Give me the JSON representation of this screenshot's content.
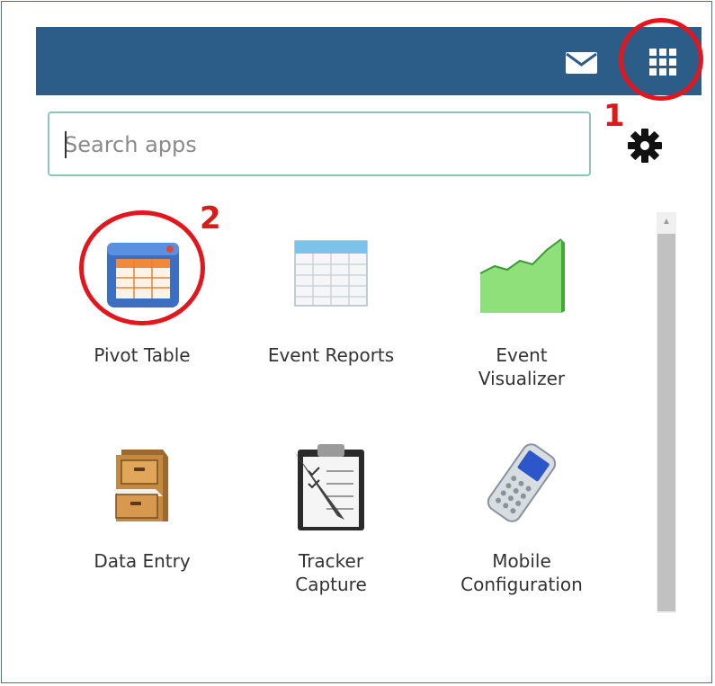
{
  "header": {
    "mail_icon": "mail-icon",
    "apps_icon": "apps-grid-icon",
    "background": "#2b5d88"
  },
  "annotations": {
    "step1": "1",
    "step2": "2",
    "color": "#e3161d"
  },
  "search": {
    "placeholder": "Search apps",
    "value": ""
  },
  "settings_icon": "gear-icon",
  "apps": [
    {
      "label_lines": [
        "Pivot Table"
      ],
      "icon": "pivot-table-icon"
    },
    {
      "label_lines": [
        "Event Reports"
      ],
      "icon": "event-reports-icon"
    },
    {
      "label_lines": [
        "Event",
        "Visualizer"
      ],
      "icon": "event-visualizer-icon"
    },
    {
      "label_lines": [
        "Data Entry"
      ],
      "icon": "data-entry-icon"
    },
    {
      "label_lines": [
        "Tracker",
        "Capture"
      ],
      "icon": "tracker-capture-icon"
    },
    {
      "label_lines": [
        "Mobile",
        "Configuration"
      ],
      "icon": "mobile-configuration-icon"
    }
  ]
}
